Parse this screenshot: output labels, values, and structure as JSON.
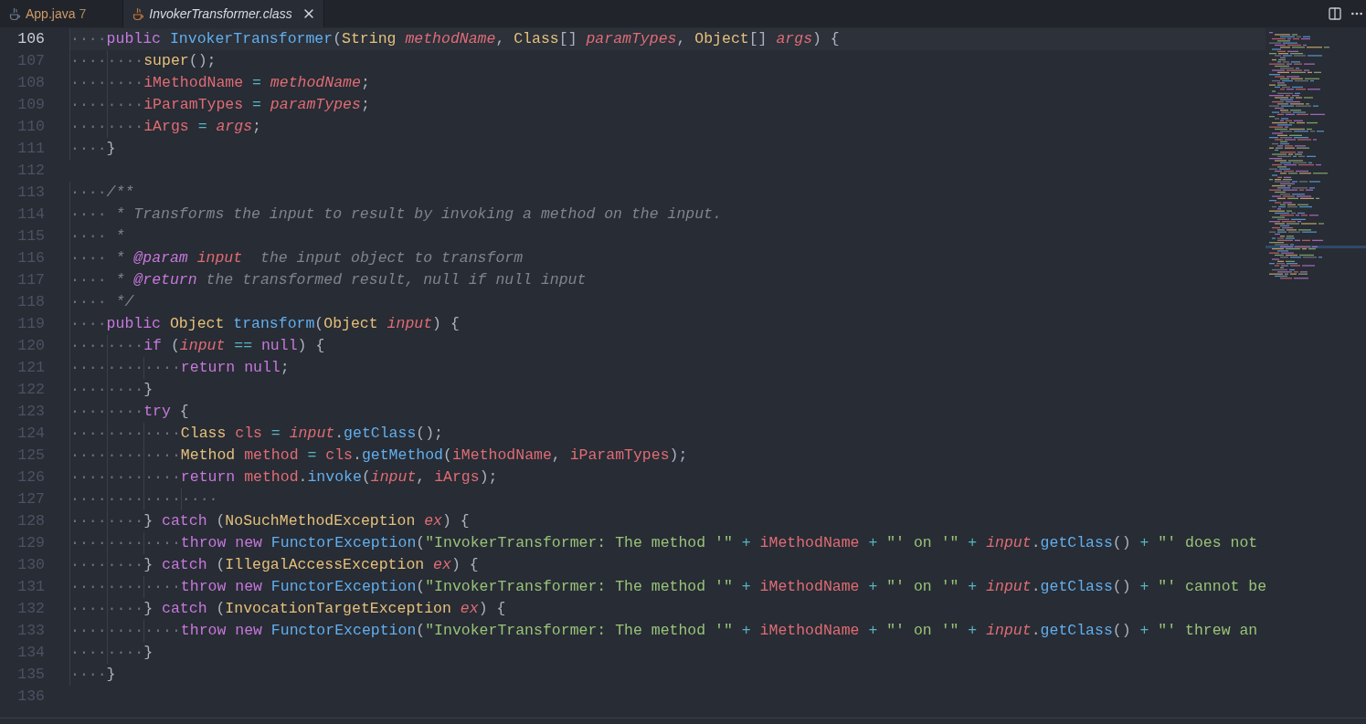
{
  "tabs": [
    {
      "label": "App.java",
      "badge": "7",
      "selected": false
    },
    {
      "label": "InvokerTransformer.class",
      "selected": true
    }
  ],
  "editor": {
    "lines": [
      {
        "number": "106",
        "current": true,
        "tokens": [
          {
            "kind": "ws",
            "text": "····"
          },
          {
            "kind": "kw",
            "text": "public "
          },
          {
            "kind": "fn",
            "text": "InvokerTransformer"
          },
          {
            "kind": "pl",
            "text": "("
          },
          {
            "kind": "ty",
            "text": "String "
          },
          {
            "kind": "par",
            "text": "methodName"
          },
          {
            "kind": "pl",
            "text": ", "
          },
          {
            "kind": "ty",
            "text": "Class"
          },
          {
            "kind": "pl",
            "text": "[] "
          },
          {
            "kind": "par",
            "text": "paramTypes"
          },
          {
            "kind": "pl",
            "text": ", "
          },
          {
            "kind": "ty",
            "text": "Object"
          },
          {
            "kind": "pl",
            "text": "[] "
          },
          {
            "kind": "par",
            "text": "args"
          },
          {
            "kind": "pl",
            "text": ") {"
          }
        ]
      },
      {
        "number": "107",
        "current": false,
        "tokens": [
          {
            "kind": "ws",
            "text": "········"
          },
          {
            "kind": "ty",
            "text": "super"
          },
          {
            "kind": "pl",
            "text": "();"
          }
        ]
      },
      {
        "number": "108",
        "current": false,
        "tokens": [
          {
            "kind": "ws",
            "text": "········"
          },
          {
            "kind": "var",
            "text": "iMethodName "
          },
          {
            "kind": "op",
            "text": "= "
          },
          {
            "kind": "par",
            "text": "methodName"
          },
          {
            "kind": "pl",
            "text": ";"
          }
        ]
      },
      {
        "number": "109",
        "current": false,
        "tokens": [
          {
            "kind": "ws",
            "text": "········"
          },
          {
            "kind": "var",
            "text": "iParamTypes "
          },
          {
            "kind": "op",
            "text": "= "
          },
          {
            "kind": "par",
            "text": "paramTypes"
          },
          {
            "kind": "pl",
            "text": ";"
          }
        ]
      },
      {
        "number": "110",
        "current": false,
        "tokens": [
          {
            "kind": "ws",
            "text": "········"
          },
          {
            "kind": "var",
            "text": "iArgs "
          },
          {
            "kind": "op",
            "text": "= "
          },
          {
            "kind": "par",
            "text": "args"
          },
          {
            "kind": "pl",
            "text": ";"
          }
        ]
      },
      {
        "number": "111",
        "current": false,
        "tokens": [
          {
            "kind": "ws",
            "text": "····"
          },
          {
            "kind": "pl",
            "text": "}"
          }
        ]
      },
      {
        "number": "112",
        "current": false
      },
      {
        "number": "113",
        "current": false,
        "tokens": [
          {
            "kind": "ws",
            "text": "····"
          },
          {
            "kind": "cm",
            "text": "/**"
          }
        ]
      },
      {
        "number": "114",
        "current": false,
        "tokens": [
          {
            "kind": "ws",
            "text": "····"
          },
          {
            "kind": "cm",
            "text": " * Transforms the input to result by invoking a method on the input."
          }
        ]
      },
      {
        "number": "115",
        "current": false,
        "tokens": [
          {
            "kind": "ws",
            "text": "····"
          },
          {
            "kind": "cm",
            "text": " *"
          }
        ]
      },
      {
        "number": "116",
        "current": false,
        "tokens": [
          {
            "kind": "ws",
            "text": "····"
          },
          {
            "kind": "cm",
            "text": " * "
          },
          {
            "kind": "tag",
            "text": "@param"
          },
          {
            "kind": "par",
            "text": " input"
          },
          {
            "kind": "cm",
            "text": "  the input object to transform"
          }
        ]
      },
      {
        "number": "117",
        "current": false,
        "tokens": [
          {
            "kind": "ws",
            "text": "····"
          },
          {
            "kind": "cm",
            "text": " * "
          },
          {
            "kind": "tag",
            "text": "@return"
          },
          {
            "kind": "cm",
            "text": " the transformed result, null if null input"
          }
        ]
      },
      {
        "number": "118",
        "current": false,
        "tokens": [
          {
            "kind": "ws",
            "text": "····"
          },
          {
            "kind": "cm",
            "text": " */"
          }
        ]
      },
      {
        "number": "119",
        "current": false,
        "tokens": [
          {
            "kind": "ws",
            "text": "····"
          },
          {
            "kind": "kw",
            "text": "public "
          },
          {
            "kind": "ty",
            "text": "Object "
          },
          {
            "kind": "fn",
            "text": "transform"
          },
          {
            "kind": "pl",
            "text": "("
          },
          {
            "kind": "ty",
            "text": "Object "
          },
          {
            "kind": "par",
            "text": "input"
          },
          {
            "kind": "pl",
            "text": ") {"
          }
        ]
      },
      {
        "number": "120",
        "current": false,
        "tokens": [
          {
            "kind": "ws",
            "text": "········"
          },
          {
            "kind": "kw",
            "text": "if "
          },
          {
            "kind": "pl",
            "text": "("
          },
          {
            "kind": "par",
            "text": "input"
          },
          {
            "kind": "op",
            "text": " == "
          },
          {
            "kind": "kw",
            "text": "null"
          },
          {
            "kind": "pl",
            "text": ") {"
          }
        ]
      },
      {
        "number": "121",
        "current": false,
        "tokens": [
          {
            "kind": "ws",
            "text": "············"
          },
          {
            "kind": "kw",
            "text": "return "
          },
          {
            "kind": "kw",
            "text": "null"
          },
          {
            "kind": "pl",
            "text": ";"
          }
        ]
      },
      {
        "number": "122",
        "current": false,
        "tokens": [
          {
            "kind": "ws",
            "text": "········"
          },
          {
            "kind": "pl",
            "text": "}"
          }
        ]
      },
      {
        "number": "123",
        "current": false,
        "tokens": [
          {
            "kind": "ws",
            "text": "········"
          },
          {
            "kind": "kw",
            "text": "try "
          },
          {
            "kind": "pl",
            "text": "{"
          }
        ]
      },
      {
        "number": "124",
        "current": false,
        "tokens": [
          {
            "kind": "ws",
            "text": "············"
          },
          {
            "kind": "ty",
            "text": "Class "
          },
          {
            "kind": "var",
            "text": "cls "
          },
          {
            "kind": "op",
            "text": "= "
          },
          {
            "kind": "par",
            "text": "input"
          },
          {
            "kind": "pl",
            "text": "."
          },
          {
            "kind": "fn",
            "text": "getClass"
          },
          {
            "kind": "pl",
            "text": "();"
          }
        ]
      },
      {
        "number": "125",
        "current": false,
        "tokens": [
          {
            "kind": "ws",
            "text": "············"
          },
          {
            "kind": "ty",
            "text": "Method "
          },
          {
            "kind": "var",
            "text": "method "
          },
          {
            "kind": "op",
            "text": "= "
          },
          {
            "kind": "var",
            "text": "cls"
          },
          {
            "kind": "pl",
            "text": "."
          },
          {
            "kind": "fn",
            "text": "getMethod"
          },
          {
            "kind": "pl",
            "text": "("
          },
          {
            "kind": "var",
            "text": "iMethodName"
          },
          {
            "kind": "pl",
            "text": ", "
          },
          {
            "kind": "var",
            "text": "iParamTypes"
          },
          {
            "kind": "pl",
            "text": ");"
          }
        ]
      },
      {
        "number": "126",
        "current": false,
        "tokens": [
          {
            "kind": "ws",
            "text": "············"
          },
          {
            "kind": "kw",
            "text": "return "
          },
          {
            "kind": "var",
            "text": "method"
          },
          {
            "kind": "pl",
            "text": "."
          },
          {
            "kind": "fn",
            "text": "invoke"
          },
          {
            "kind": "pl",
            "text": "("
          },
          {
            "kind": "par",
            "text": "input"
          },
          {
            "kind": "pl",
            "text": ", "
          },
          {
            "kind": "var",
            "text": "iArgs"
          },
          {
            "kind": "pl",
            "text": ");"
          }
        ]
      },
      {
        "number": "127",
        "current": false,
        "tokens": [
          {
            "kind": "ws",
            "text": "················"
          }
        ]
      },
      {
        "number": "128",
        "current": false,
        "tokens": [
          {
            "kind": "ws",
            "text": "········"
          },
          {
            "kind": "pl",
            "text": "} "
          },
          {
            "kind": "kw",
            "text": "catch "
          },
          {
            "kind": "pl",
            "text": "("
          },
          {
            "kind": "ty",
            "text": "NoSuchMethodException "
          },
          {
            "kind": "par",
            "text": "ex"
          },
          {
            "kind": "pl",
            "text": ") {"
          }
        ]
      },
      {
        "number": "129",
        "current": false,
        "tokens": [
          {
            "kind": "ws",
            "text": "············"
          },
          {
            "kind": "kw",
            "text": "throw "
          },
          {
            "kind": "kw",
            "text": "new "
          },
          {
            "kind": "fn",
            "text": "FunctorException"
          },
          {
            "kind": "pl",
            "text": "("
          },
          {
            "kind": "str",
            "text": "\"InvokerTransformer: The method '\" "
          },
          {
            "kind": "op",
            "text": "+ "
          },
          {
            "kind": "var",
            "text": "iMethodName "
          },
          {
            "kind": "op",
            "text": "+ "
          },
          {
            "kind": "str",
            "text": "\"' on '\" "
          },
          {
            "kind": "op",
            "text": "+ "
          },
          {
            "kind": "par",
            "text": "input"
          },
          {
            "kind": "pl",
            "text": "."
          },
          {
            "kind": "fn",
            "text": "getClass"
          },
          {
            "kind": "pl",
            "text": "() "
          },
          {
            "kind": "op",
            "text": "+ "
          },
          {
            "kind": "str",
            "text": "\"' does not"
          }
        ]
      },
      {
        "number": "130",
        "current": false,
        "tokens": [
          {
            "kind": "ws",
            "text": "········"
          },
          {
            "kind": "pl",
            "text": "} "
          },
          {
            "kind": "kw",
            "text": "catch "
          },
          {
            "kind": "pl",
            "text": "("
          },
          {
            "kind": "ty",
            "text": "IllegalAccessException "
          },
          {
            "kind": "par",
            "text": "ex"
          },
          {
            "kind": "pl",
            "text": ") {"
          }
        ]
      },
      {
        "number": "131",
        "current": false,
        "tokens": [
          {
            "kind": "ws",
            "text": "············"
          },
          {
            "kind": "kw",
            "text": "throw "
          },
          {
            "kind": "kw",
            "text": "new "
          },
          {
            "kind": "fn",
            "text": "FunctorException"
          },
          {
            "kind": "pl",
            "text": "("
          },
          {
            "kind": "str",
            "text": "\"InvokerTransformer: The method '\" "
          },
          {
            "kind": "op",
            "text": "+ "
          },
          {
            "kind": "var",
            "text": "iMethodName "
          },
          {
            "kind": "op",
            "text": "+ "
          },
          {
            "kind": "str",
            "text": "\"' on '\" "
          },
          {
            "kind": "op",
            "text": "+ "
          },
          {
            "kind": "par",
            "text": "input"
          },
          {
            "kind": "pl",
            "text": "."
          },
          {
            "kind": "fn",
            "text": "getClass"
          },
          {
            "kind": "pl",
            "text": "() "
          },
          {
            "kind": "op",
            "text": "+ "
          },
          {
            "kind": "str",
            "text": "\"' cannot be"
          }
        ]
      },
      {
        "number": "132",
        "current": false,
        "tokens": [
          {
            "kind": "ws",
            "text": "········"
          },
          {
            "kind": "pl",
            "text": "} "
          },
          {
            "kind": "kw",
            "text": "catch "
          },
          {
            "kind": "pl",
            "text": "("
          },
          {
            "kind": "ty",
            "text": "InvocationTargetException "
          },
          {
            "kind": "par",
            "text": "ex"
          },
          {
            "kind": "pl",
            "text": ") {"
          }
        ]
      },
      {
        "number": "133",
        "current": false,
        "tokens": [
          {
            "kind": "ws",
            "text": "············"
          },
          {
            "kind": "kw",
            "text": "throw "
          },
          {
            "kind": "kw",
            "text": "new "
          },
          {
            "kind": "fn",
            "text": "FunctorException"
          },
          {
            "kind": "pl",
            "text": "("
          },
          {
            "kind": "str",
            "text": "\"InvokerTransformer: The method '\" "
          },
          {
            "kind": "op",
            "text": "+ "
          },
          {
            "kind": "var",
            "text": "iMethodName "
          },
          {
            "kind": "op",
            "text": "+ "
          },
          {
            "kind": "str",
            "text": "\"' on '\" "
          },
          {
            "kind": "op",
            "text": "+ "
          },
          {
            "kind": "par",
            "text": "input"
          },
          {
            "kind": "pl",
            "text": "."
          },
          {
            "kind": "fn",
            "text": "getClass"
          },
          {
            "kind": "pl",
            "text": "() "
          },
          {
            "kind": "op",
            "text": "+ "
          },
          {
            "kind": "str",
            "text": "\"' threw an"
          }
        ]
      },
      {
        "number": "134",
        "current": false,
        "tokens": [
          {
            "kind": "ws",
            "text": "········"
          },
          {
            "kind": "pl",
            "text": "}"
          }
        ]
      },
      {
        "number": "135",
        "current": false,
        "tokens": [
          {
            "kind": "ws",
            "text": "····"
          },
          {
            "kind": "pl",
            "text": "}"
          }
        ]
      },
      {
        "number": "136",
        "current": false
      }
    ]
  }
}
